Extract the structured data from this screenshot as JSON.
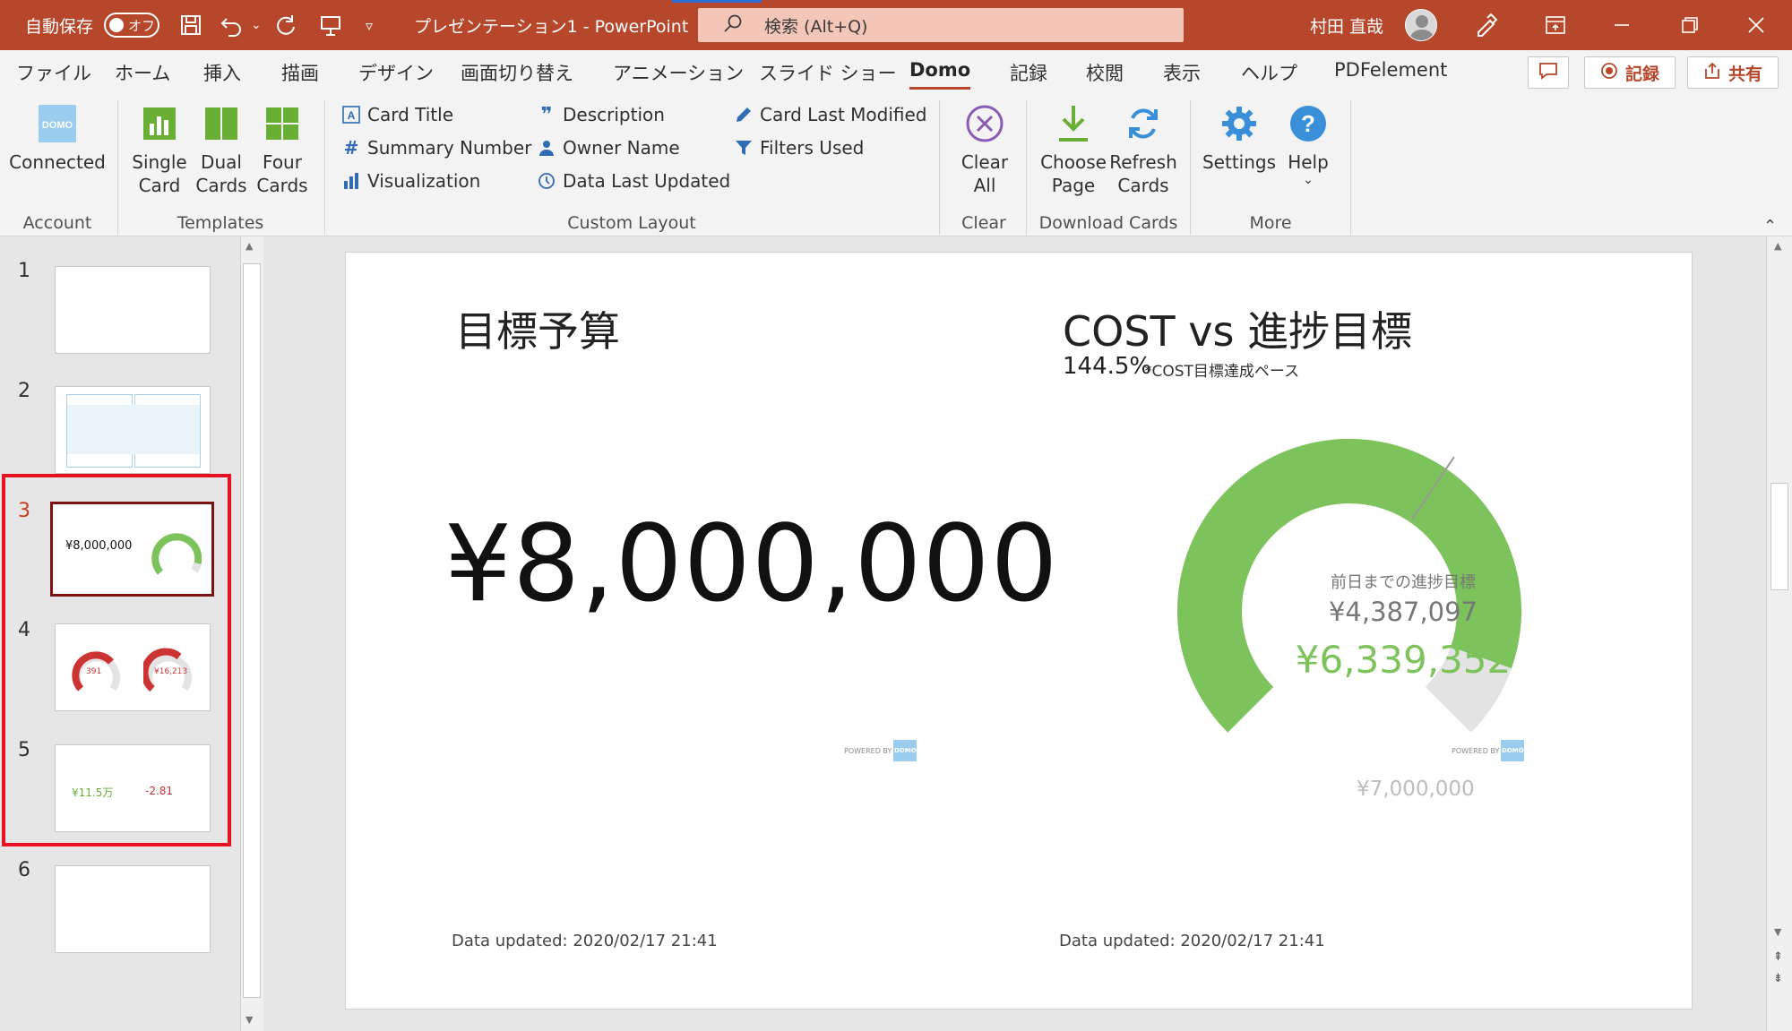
{
  "titlebar": {
    "autosave_label": "自動保存",
    "autosave_state": "オフ",
    "document_title": "プレゼンテーション1  -  PowerPoint",
    "search_placeholder": "検索 (Alt+Q)",
    "user_name": "村田 直哉"
  },
  "tabs": [
    "ファイル",
    "ホーム",
    "挿入",
    "描画",
    "デザイン",
    "画面切り替え",
    "アニメーション",
    "スライド ショー",
    "Domo",
    "記録",
    "校閲",
    "表示",
    "ヘルプ",
    "PDFelement"
  ],
  "active_tab": "Domo",
  "tab_buttons": {
    "record": "記録",
    "share": "共有"
  },
  "ribbon": {
    "account": {
      "connected": "Connected",
      "group": "Account"
    },
    "templates": {
      "single": [
        "Single",
        "Card"
      ],
      "dual": [
        "Dual",
        "Cards"
      ],
      "four": [
        "Four",
        "Cards"
      ],
      "group": "Templates"
    },
    "custom_layout": {
      "card_title": "Card Title",
      "summary_number": "Summary Number",
      "visualization": "Visualization",
      "description": "Description",
      "owner_name": "Owner Name",
      "data_last_updated": "Data Last Updated",
      "card_last_modified": "Card Last Modified",
      "filters_used": "Filters Used",
      "group": "Custom Layout"
    },
    "clear": {
      "clear_all": [
        "Clear",
        "All"
      ],
      "group": "Clear"
    },
    "download": {
      "choose_page": [
        "Choose",
        "Page"
      ],
      "refresh_cards": [
        "Refresh",
        "Cards"
      ],
      "group": "Download Cards"
    },
    "more": {
      "settings": "Settings",
      "help": "Help",
      "group": "More"
    }
  },
  "slides": [
    {
      "num": "1"
    },
    {
      "num": "2"
    },
    {
      "num": "3",
      "current": true
    },
    {
      "num": "4"
    },
    {
      "num": "5"
    },
    {
      "num": "6"
    }
  ],
  "thumb3": {
    "value": "¥8,000,000"
  },
  "thumb4": {
    "left_value": "391",
    "right_value": "¥16,213"
  },
  "thumb5": {
    "left_value": "¥11.5万",
    "right_value": "-2.81"
  },
  "slide": {
    "left_title": "目標予算",
    "big_number": "¥8,000,000",
    "right_title": "COST vs 進捗目標",
    "summary_value": "144.5%",
    "summary_desc": "*COST目標達成ペース",
    "gauge": {
      "label": "前日までの進捗目標",
      "target": "¥4,387,097",
      "value_text": "¥6,339,352",
      "max_label": "¥7,000,000",
      "value": 6339352,
      "target_value": 4387097,
      "max": 7000000,
      "color_fill": "#7dc35b",
      "color_track": "#e3e3e3"
    },
    "powered_by": "POWERED BY",
    "domo_logo": "DOMO",
    "left_updated": "Data updated: 2020/02/17 21:41",
    "right_updated": "Data updated: 2020/02/17 21:41"
  },
  "colors": {
    "accent": "#b7472a",
    "domo_blue": "#99ccee",
    "green": "#6aaf35",
    "selection": "#e81123"
  }
}
